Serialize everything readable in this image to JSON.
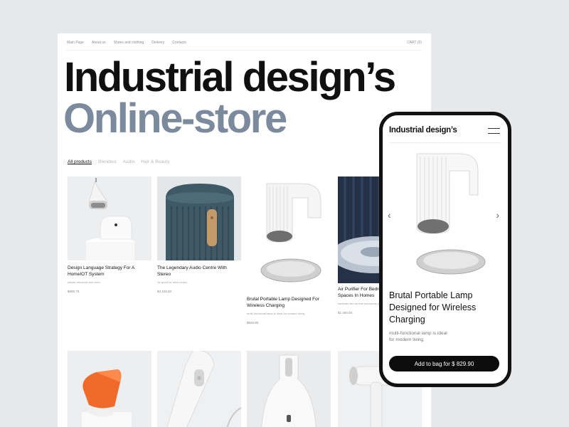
{
  "nav": {
    "items": [
      "Main Page",
      "About us",
      "Shoes and clothing",
      "Delivery",
      "Contacts"
    ],
    "cart": "CART (0)"
  },
  "hero": {
    "line1": "Industrial design’s",
    "line2": "Online-store"
  },
  "filters": [
    "All products",
    "Blenders",
    "Audio",
    "Hair & Beauty"
  ],
  "products": [
    {
      "name": "Design Language Strategy For A HomeIOT System",
      "desc": "simple structure and color",
      "price": "$699.70"
    },
    {
      "name": "The Legendary Audio Centre With Stereo",
      "desc": "So good for retro music",
      "price": "$3 429.00"
    },
    {
      "name": "Brutal Portable Lamp Designed For Wireless Charging",
      "desc": "multi-functional lamp is ideal for modern living",
      "price": "$829.90"
    },
    {
      "name": "Air Purifier For Bedrooms & Private Spaces In Homes",
      "desc": "minimize the air that surrounds you",
      "price": "$1 300.00"
    }
  ],
  "mobile": {
    "title": "Industrial design’s",
    "product_name": "Brutal Portable Lamp Designed for Wireless Charging",
    "product_desc": "multi-functional lamp is ideal for modern living.",
    "cta": "Add to bag for $ 829.90"
  },
  "colors": {
    "accent": "#7b8b9d",
    "dark": "#0c0c0c",
    "page_bg": "#e7e8ea"
  }
}
